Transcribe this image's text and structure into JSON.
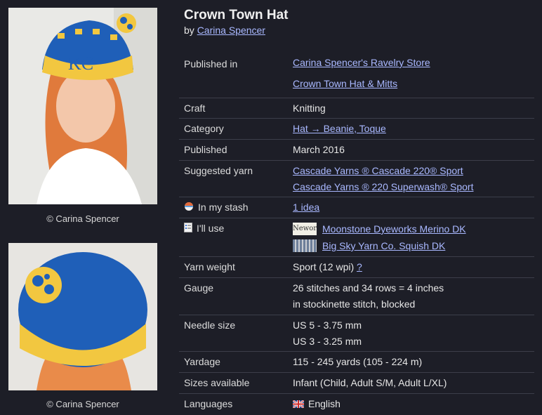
{
  "photos": [
    {
      "caption": "© Carina Spencer"
    },
    {
      "caption": "© Carina Spencer"
    }
  ],
  "pattern": {
    "title": "Crown Town Hat",
    "by_prefix": "by",
    "designer": "Carina Spencer"
  },
  "details": {
    "published_in": {
      "label": "Published in",
      "values": [
        "Carina Spencer's Ravelry Store",
        "Crown Town Hat & Mitts"
      ]
    },
    "craft": {
      "label": "Craft",
      "value": "Knitting"
    },
    "category": {
      "label": "Category",
      "value": "Hat → Beanie, Toque"
    },
    "published": {
      "label": "Published",
      "value": "March 2016"
    },
    "suggested_yarn": {
      "label": "Suggested yarn",
      "values": [
        "Cascade Yarns ® Cascade 220® Sport",
        "Cascade Yarns ® 220 Superwash® Sport"
      ]
    },
    "in_my_stash": {
      "label": "In my stash",
      "value": "1 idea"
    },
    "ill_use": {
      "label": "I'll use",
      "yarns": [
        "Moonstone Dyeworks Merino DK",
        "Big Sky Yarn Co. Squish DK"
      ],
      "thumb_text": "Newor"
    },
    "yarn_weight": {
      "label": "Yarn weight",
      "value": "Sport (12 wpi)",
      "help": "?"
    },
    "gauge": {
      "label": "Gauge",
      "values": [
        "26 stitches and 34 rows = 4 inches",
        "in stockinette stitch, blocked"
      ]
    },
    "needle_size": {
      "label": "Needle size",
      "values": [
        "US 5 - 3.75 mm",
        "US 3 - 3.25 mm"
      ]
    },
    "yardage": {
      "label": "Yardage",
      "value": "115 - 245 yards (105 - 224 m)"
    },
    "sizes": {
      "label": "Sizes available",
      "value": "Infant (Child, Adult S/M, Adult L/XL)"
    },
    "languages": {
      "label": "Languages",
      "value": "English"
    }
  },
  "colors": {
    "background": "#1d1e27",
    "link": "#a9b8ff",
    "hat_blue": "#1f5fb8",
    "hat_yellow": "#f2c740"
  }
}
